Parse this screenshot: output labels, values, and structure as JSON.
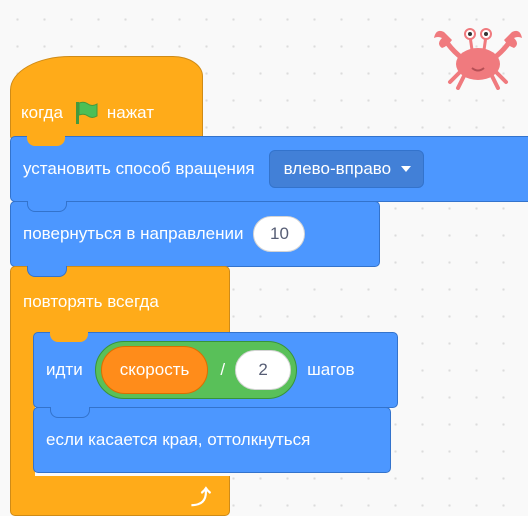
{
  "script": {
    "hat": {
      "when_label": "когда",
      "clicked_label": "нажат",
      "flag_icon": "green-flag-icon"
    },
    "rotation_block": {
      "label": "установить способ вращения",
      "dropdown_value": "влево-вправо"
    },
    "direction_block": {
      "label": "повернуться в направлении",
      "value": "10"
    },
    "forever_block": {
      "label": "повторять всегда",
      "loop_icon": "loop-arrow-icon"
    },
    "move_block": {
      "label_before": "идти",
      "operator": {
        "variable": "скорость",
        "symbol": "/",
        "value": "2"
      },
      "label_after": "шагов"
    },
    "bounce_block": {
      "label": "если касается края, оттолкнуться"
    }
  },
  "sprite": {
    "name": "crab-sprite"
  },
  "colors": {
    "events": "#ffab19",
    "control": "#ffab19",
    "motion": "#4c97ff",
    "operators": "#59c059",
    "variables": "#ff8c1a",
    "flag": "#4cbf56",
    "sprite": "#f07a7e"
  }
}
